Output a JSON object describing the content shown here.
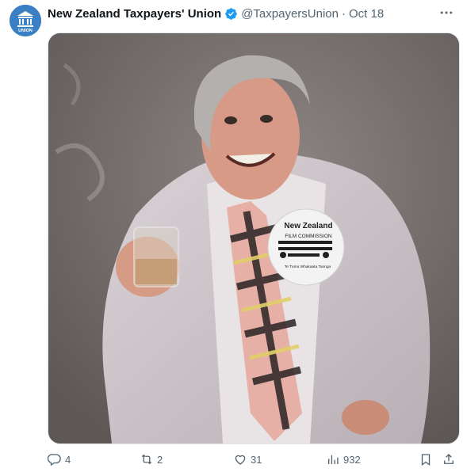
{
  "tweet": {
    "display_name": "New Zealand Taxpayers' Union",
    "handle": "@TaxpayersUnion",
    "separator": "·",
    "date": "Oct 18",
    "avatar_text": "UNION",
    "verified_icon": "verified-badge-icon",
    "more_icon": "more-dots-icon"
  },
  "media": {
    "badge_line1": "New Zealand",
    "badge_line2": "FILM COMMISSION",
    "badge_line3": "Te Tumu Whakaata Taonga"
  },
  "actions": {
    "reply": {
      "icon": "reply-icon",
      "count": "4"
    },
    "retweet": {
      "icon": "retweet-icon",
      "count": "2"
    },
    "like": {
      "icon": "heart-icon",
      "count": "31"
    },
    "views": {
      "icon": "views-icon",
      "count": "932"
    },
    "bookmark": {
      "icon": "bookmark-icon"
    },
    "share": {
      "icon": "share-icon"
    }
  },
  "colors": {
    "text_primary": "#0f1419",
    "text_secondary": "#536471",
    "verified_blue": "#1d9bf0",
    "avatar_blue": "#3b7fc4"
  }
}
